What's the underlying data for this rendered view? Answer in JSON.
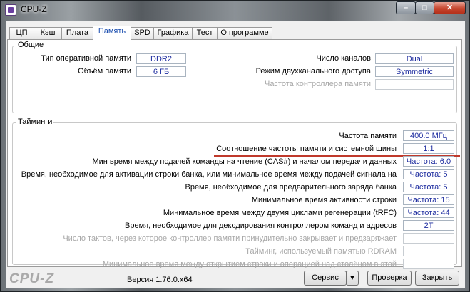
{
  "window": {
    "title": "CPU-Z",
    "min_glyph": "–",
    "max_glyph": "□",
    "close_glyph": "✕"
  },
  "tabs": [
    "ЦП",
    "Кэш",
    "Плата",
    "Память",
    "SPD",
    "Графика",
    "Тест",
    "О программе"
  ],
  "active_tab": "Память",
  "general": {
    "title": "Общие",
    "type_label": "Тип оперативной памяти",
    "type_value": "DDR2",
    "size_label": "Объём памяти",
    "size_value": "6 ГБ",
    "channels_label": "Число каналов",
    "channels_value": "Dual",
    "dc_mode_label": "Режим двухканального доступа",
    "dc_mode_value": "Symmetric",
    "nb_freq_label": "Частота контроллера памяти",
    "nb_freq_value": ""
  },
  "timings": {
    "title": "Тайминги",
    "rows": [
      {
        "label": "Частота памяти",
        "value": "400.0 МГц",
        "disabled": false
      },
      {
        "label": "Соотношение частоты памяти и системной шины",
        "value": "1:1",
        "disabled": false
      },
      {
        "label": "Мин время между подачей команды на чтение (CAS#) и началом передачи данных",
        "value": "Частота: 6.0",
        "disabled": false
      },
      {
        "label": "Время, необходимое для активации строки банка, или минимальное время между подачей сигнала на",
        "value": "Частота: 5",
        "disabled": false
      },
      {
        "label": "Время, необходимое для предварительного заряда банка",
        "value": "Частота: 5",
        "disabled": false
      },
      {
        "label": "Минимальное время активности строки",
        "value": "Частота: 15",
        "disabled": false
      },
      {
        "label": "Минимальное время между двумя циклами регенерации (tRFC)",
        "value": "Частота: 44",
        "disabled": false
      },
      {
        "label": "Время, необходимое для декодирования контроллером команд и адресов",
        "value": "2T",
        "disabled": false
      },
      {
        "label": "Число тактов, через которое контроллер памяти принудительно закрывает и предзаряжает",
        "value": "",
        "disabled": true
      },
      {
        "label": "Тайминг, используемый памятью RDRAM",
        "value": "",
        "disabled": true
      },
      {
        "label": "Минимальное время между открытием строки и операцией над столбцом в этой",
        "value": "",
        "disabled": true
      }
    ]
  },
  "footer": {
    "logo": "CPU-Z",
    "version": "Версия 1.76.0.x64",
    "service": "Сервис",
    "dropdown_glyph": "▼",
    "validate": "Проверка",
    "close": "Закрыть"
  },
  "colors": {
    "value_text": "#1d2c9f",
    "highlight_underline": "#c0392b",
    "active_tab_text": "#1c4fb0"
  }
}
